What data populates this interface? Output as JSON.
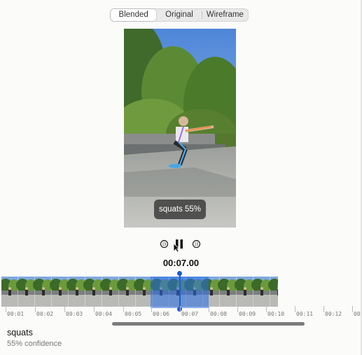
{
  "view_modes": {
    "options": [
      "Blended",
      "Original",
      "Wireframe"
    ],
    "selected": "Blended"
  },
  "video": {
    "overlay_label": "squats 55%"
  },
  "transport": {
    "skip_back_icon": "rewind-15-icon",
    "play_pause_icon": "pause-icon",
    "skip_forward_icon": "forward-15-icon",
    "current_time": "00:07.00"
  },
  "timeline": {
    "tick_labels": [
      "00:01",
      "00:02",
      "00:03",
      "00:04",
      "00:05",
      "00:06",
      "00:07",
      "00:08",
      "00:09",
      "00:10",
      "00:11",
      "00:12",
      "00:"
    ],
    "playhead_time": "00:07.00",
    "accent_color": "#1d5bd6"
  },
  "result": {
    "action": "squats",
    "confidence_text": "55% confidence"
  }
}
